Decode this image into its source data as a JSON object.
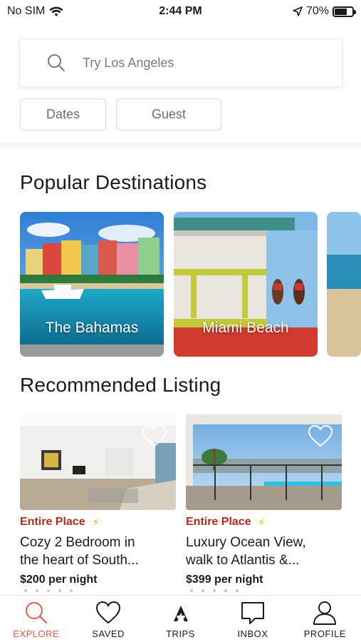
{
  "status_bar": {
    "carrier": "No SIM",
    "time": "2:44 PM",
    "battery": "70%",
    "battery_level": 0.7
  },
  "search": {
    "placeholder": "Try Los Angeles",
    "icon": "search-icon"
  },
  "filters": {
    "dates_label": "Dates",
    "guest_label": "Guest"
  },
  "sections": {
    "popular_title": "Popular Destinations",
    "recommended_title": "Recommended Listing"
  },
  "destinations": [
    {
      "name": "The Bahamas"
    },
    {
      "name": "Miami Beach"
    },
    {
      "name": ""
    }
  ],
  "listings": [
    {
      "type": "Entire Place",
      "title_line1": "Cozy 2 Bedroom in",
      "title_line2": "the heart of South...",
      "price": "$200 per night"
    },
    {
      "type": "Entire Place",
      "title_line1": "Luxury Ocean View,",
      "title_line2": "walk to Atlantis &...",
      "price": "$399 per night"
    }
  ],
  "tabs": [
    {
      "label": "EXPLORE",
      "icon": "search-icon",
      "active": true
    },
    {
      "label": "SAVED",
      "icon": "heart-icon",
      "active": false
    },
    {
      "label": "TRIPS",
      "icon": "trips-icon",
      "active": false
    },
    {
      "label": "INBOX",
      "icon": "chat-bubble-icon",
      "active": false
    },
    {
      "label": "PROFILE",
      "icon": "person-icon",
      "active": false
    }
  ],
  "colors": {
    "accent": "#e0594a",
    "listing_type": "#b32b1f",
    "bolt": "#f2b705"
  }
}
